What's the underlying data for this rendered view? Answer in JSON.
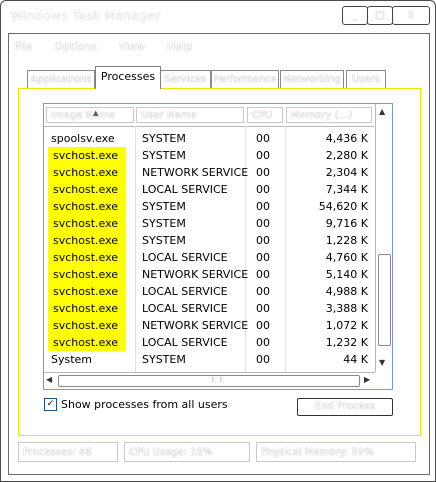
{
  "window": {
    "title": "Windows Task Manager",
    "minimize": "_",
    "maximize": "□",
    "close": "X"
  },
  "menu": [
    "File",
    "Options",
    "View",
    "Help"
  ],
  "tabs": [
    {
      "label": "Applications"
    },
    {
      "label": "Processes",
      "active": true
    },
    {
      "label": "Services"
    },
    {
      "label": "Performance"
    },
    {
      "label": "Networking"
    },
    {
      "label": "Users"
    }
  ],
  "columns": {
    "name": "Image Name",
    "user": "User Name",
    "cpu": "CPU",
    "mem": "Memory (...)"
  },
  "processes": [
    {
      "name": "spoolsv.exe",
      "user": "SYSTEM",
      "cpu": "00",
      "mem": "4,436 K",
      "highlight": false
    },
    {
      "name": "svchost.exe",
      "user": "SYSTEM",
      "cpu": "00",
      "mem": "2,280 K",
      "highlight": true
    },
    {
      "name": "svchost.exe",
      "user": "NETWORK SERVICE",
      "cpu": "00",
      "mem": "2,304 K",
      "highlight": true
    },
    {
      "name": "svchost.exe",
      "user": "LOCAL SERVICE",
      "cpu": "00",
      "mem": "7,344 K",
      "highlight": true
    },
    {
      "name": "svchost.exe",
      "user": "SYSTEM",
      "cpu": "00",
      "mem": "54,620 K",
      "highlight": true
    },
    {
      "name": "svchost.exe",
      "user": "SYSTEM",
      "cpu": "00",
      "mem": "9,716 K",
      "highlight": true
    },
    {
      "name": "svchost.exe",
      "user": "SYSTEM",
      "cpu": "00",
      "mem": "1,228 K",
      "highlight": true
    },
    {
      "name": "svchost.exe",
      "user": "LOCAL SERVICE",
      "cpu": "00",
      "mem": "4,760 K",
      "highlight": true
    },
    {
      "name": "svchost.exe",
      "user": "NETWORK SERVICE",
      "cpu": "00",
      "mem": "5,140 K",
      "highlight": true
    },
    {
      "name": "svchost.exe",
      "user": "LOCAL SERVICE",
      "cpu": "00",
      "mem": "4,988 K",
      "highlight": true
    },
    {
      "name": "svchost.exe",
      "user": "LOCAL SERVICE",
      "cpu": "00",
      "mem": "3,388 K",
      "highlight": true
    },
    {
      "name": "svchost.exe",
      "user": "NETWORK SERVICE",
      "cpu": "00",
      "mem": "1,072 K",
      "highlight": true
    },
    {
      "name": "svchost.exe",
      "user": "LOCAL SERVICE",
      "cpu": "00",
      "mem": "1,232 K",
      "highlight": true
    },
    {
      "name": "System",
      "user": "SYSTEM",
      "cpu": "00",
      "mem": "44 K",
      "highlight": false
    }
  ],
  "show_all": {
    "label": "Show processes from all users",
    "checked": true,
    "check_glyph": "✓"
  },
  "end_process": "End Process",
  "status": {
    "processes": "Processes: 48",
    "cpu": "CPU Usage: 15%",
    "memory": "Physical Memory: 59%"
  },
  "colors": {
    "highlight": "#ffff00",
    "panel_border": "#e8e800"
  }
}
